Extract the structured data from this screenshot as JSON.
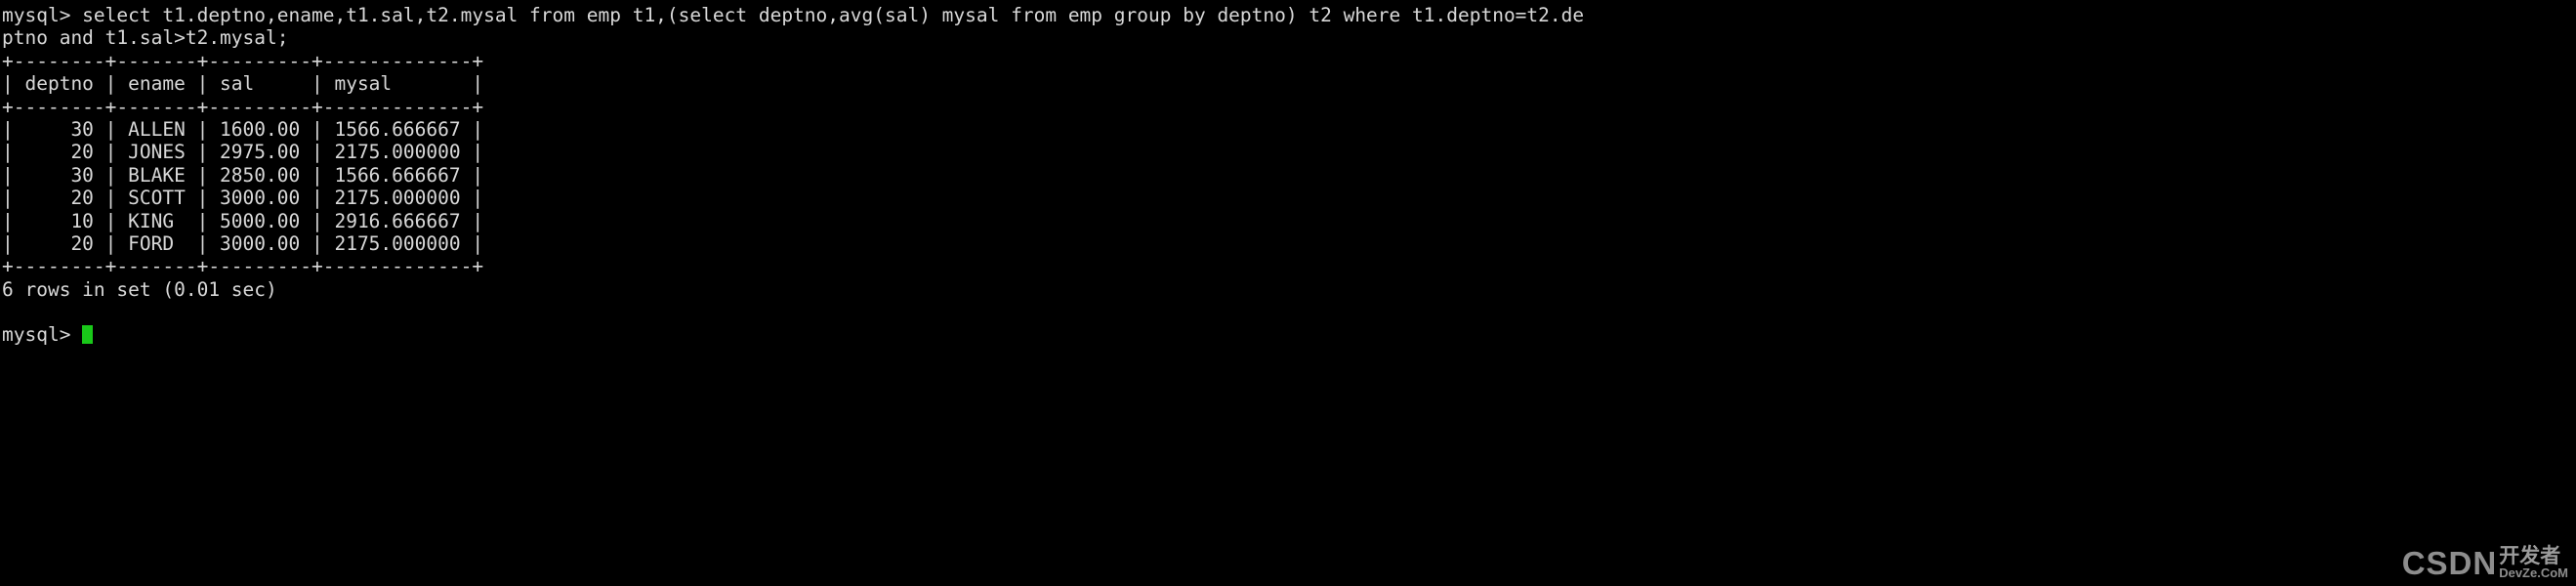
{
  "terminal": {
    "background_color": "#000000",
    "text_color": "#d8d8d8",
    "cursor_color": "#19c819",
    "lines": [
      "mysql> select t1.deptno,ename,t1.sal,t2.mysal from emp t1,(select deptno,avg(sal) mysal from emp group by deptno) t2 where t1.deptno=t2.de",
      "ptno and t1.sal>t2.mysal;",
      "+--------+-------+---------+-------------+",
      "| deptno | ename | sal     | mysal       |",
      "+--------+-------+---------+-------------+",
      "|     30 | ALLEN | 1600.00 | 1566.666667 |",
      "|     20 | JONES | 2975.00 | 2175.000000 |",
      "|     30 | BLAKE | 2850.00 | 1566.666667 |",
      "|     20 | SCOTT | 3000.00 | 2175.000000 |",
      "|     10 | KING  | 5000.00 | 2916.666667 |",
      "|     20 | FORD  | 3000.00 | 2175.000000 |",
      "+--------+-------+---------+-------------+",
      "6 rows in set (0.01 sec)",
      "",
      "mysql> "
    ],
    "prompt": "mysql> ",
    "query": {
      "statement": "select t1.deptno,ename,t1.sal,t2.mysal from emp t1,(select deptno,avg(sal) mysal from emp group by deptno) t2 where t1.deptno=t2.deptno and t1.sal>t2.mysal;"
    },
    "result_table": {
      "columns": [
        "deptno",
        "ename",
        "sal",
        "mysal"
      ],
      "rows": [
        [
          "30",
          "ALLEN",
          "1600.00",
          "1566.666667"
        ],
        [
          "20",
          "JONES",
          "2975.00",
          "2175.000000"
        ],
        [
          "30",
          "BLAKE",
          "2850.00",
          "1566.666667"
        ],
        [
          "20",
          "SCOTT",
          "3000.00",
          "2175.000000"
        ],
        [
          "10",
          "KING",
          "5000.00",
          "2916.666667"
        ],
        [
          "20",
          "FORD",
          "3000.00",
          "2175.000000"
        ]
      ],
      "status": "6 rows in set (0.01 sec)",
      "row_count": 6,
      "elapsed": "0.01 sec"
    }
  },
  "watermark": {
    "brand": "CSDN",
    "cn_top": "开发者",
    "cn_bottom": "DevZe.CoM"
  }
}
